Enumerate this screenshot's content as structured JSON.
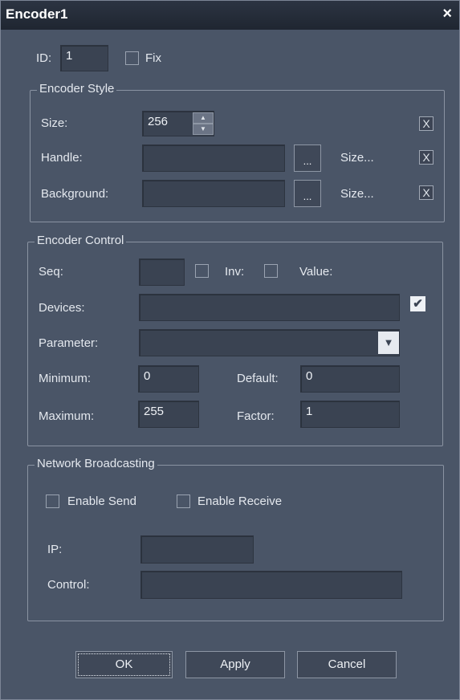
{
  "window": {
    "title": "Encoder1",
    "close_symbol": "×"
  },
  "top": {
    "id_label": "ID:",
    "id_value": "1",
    "fix_label": "Fix"
  },
  "style_group": {
    "title": "Encoder Style",
    "size_label": "Size:",
    "size_value": "256",
    "handle_label": "Handle:",
    "background_label": "Background:",
    "browse_label": "...",
    "size_link": "Size...",
    "x_mark": "X"
  },
  "control_group": {
    "title": "Encoder Control",
    "seq_label": "Seq:",
    "inv_label": "Inv:",
    "value_label": "Value:",
    "devices_label": "Devices:",
    "parameter_label": "Parameter:",
    "minimum_label": "Minimum:",
    "minimum_value": "0",
    "default_label": "Default:",
    "default_value": "0",
    "maximum_label": "Maximum:",
    "maximum_value": "255",
    "factor_label": "Factor:",
    "factor_value": "1",
    "checkmark": "✔"
  },
  "network_group": {
    "title": "Network Broadcasting",
    "enable_send": "Enable Send",
    "enable_receive": "Enable Receive",
    "ip_label": "IP:",
    "control_label": "Control:"
  },
  "buttons": {
    "ok": "OK",
    "apply": "Apply",
    "cancel": "Cancel"
  },
  "icons": {
    "spin_up": "up-arrow-icon",
    "spin_down": "down-arrow-icon",
    "dropdown": "chevron-down-icon"
  }
}
